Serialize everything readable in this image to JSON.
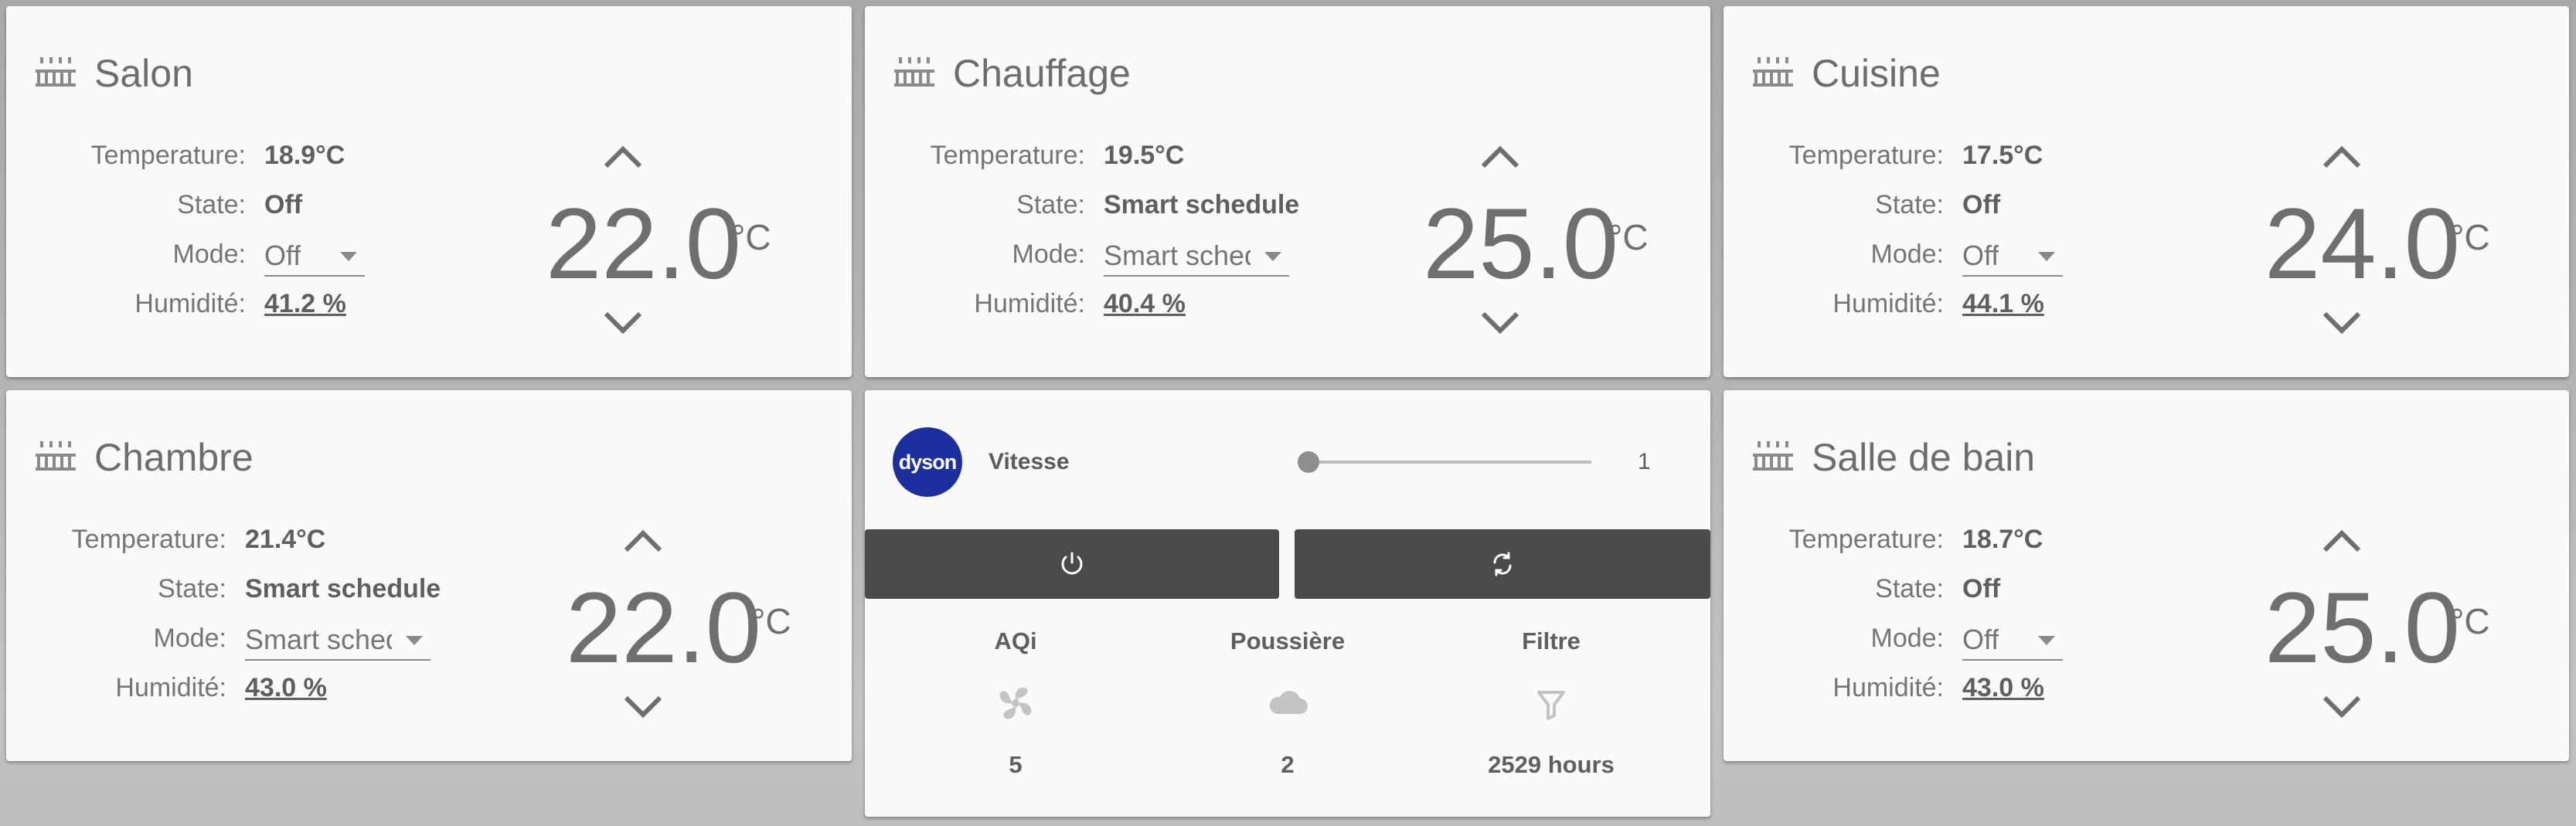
{
  "thermostats": [
    {
      "title": "Salon",
      "temperature_label": "Temperature:",
      "temperature": "18.9°C",
      "state_label": "State:",
      "state": "Off",
      "mode_label": "Mode:",
      "mode": "Off",
      "humidity_label": "Humidité:",
      "humidity": "41.2 %",
      "setpoint": "22.0",
      "unit": "°C"
    },
    {
      "title": "Chauffage",
      "temperature_label": "Temperature:",
      "temperature": "19.5°C",
      "state_label": "State:",
      "state": "Smart schedule",
      "mode_label": "Mode:",
      "mode": "Smart schedule",
      "humidity_label": "Humidité:",
      "humidity": "40.4 %",
      "setpoint": "25.0",
      "unit": "°C"
    },
    {
      "title": "Cuisine",
      "temperature_label": "Temperature:",
      "temperature": "17.5°C",
      "state_label": "State:",
      "state": "Off",
      "mode_label": "Mode:",
      "mode": "Off",
      "humidity_label": "Humidité:",
      "humidity": "44.1 %",
      "setpoint": "24.0",
      "unit": "°C"
    },
    {
      "title": "Chambre",
      "temperature_label": "Temperature:",
      "temperature": "21.4°C",
      "state_label": "State:",
      "state": "Smart schedule",
      "mode_label": "Mode:",
      "mode": "Smart schedule",
      "humidity_label": "Humidité:",
      "humidity": "43.0 %",
      "setpoint": "22.0",
      "unit": "°C"
    },
    {
      "title": "Salle de bain",
      "temperature_label": "Temperature:",
      "temperature": "18.7°C",
      "state_label": "State:",
      "state": "Off",
      "mode_label": "Mode:",
      "mode": "Off",
      "humidity_label": "Humidité:",
      "humidity": "43.0 %",
      "setpoint": "25.0",
      "unit": "°C"
    }
  ],
  "dyson": {
    "logo_text": "dyson",
    "speed_label": "Vitesse",
    "speed_value": "1",
    "speed_fraction": 0,
    "power_icon": "power-icon",
    "oscillate_icon": "sync-icon",
    "stats": [
      {
        "label": "AQi",
        "icon": "fan-icon",
        "value": "5"
      },
      {
        "label": "Poussière",
        "icon": "cloud-icon",
        "value": "2"
      },
      {
        "label": "Filtre",
        "icon": "filter-icon",
        "value": "2529 hours"
      }
    ]
  },
  "colors": {
    "dyson_logo": "#1d2f9e",
    "button_bg": "#4a4a4a",
    "card_bg": "#fafafa"
  }
}
